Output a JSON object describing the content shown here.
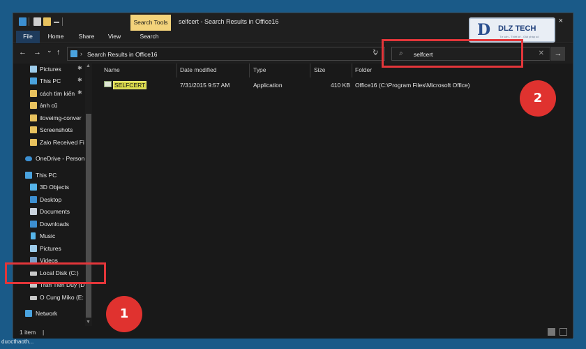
{
  "window": {
    "title": "selfcert - Search Results in Office16",
    "context_tab": "Search Tools",
    "close_icon": "×"
  },
  "ribbon": {
    "tabs": [
      "File",
      "Home",
      "Share",
      "View",
      "Search"
    ]
  },
  "nav": {
    "back": "←",
    "forward": "→",
    "recent": "⌄",
    "up": "↑"
  },
  "address": {
    "path": "Search Results in Office16",
    "separator": "›",
    "dropdown": "⌄",
    "refresh": "↻"
  },
  "search": {
    "icon": "⌕",
    "value": "selfcert",
    "clear": "✕",
    "go": "→"
  },
  "sidebar": {
    "items": [
      {
        "label": "Pictures",
        "icon": "pictures-icon",
        "pinned": true
      },
      {
        "label": "This PC",
        "icon": "pc-icon",
        "pinned": true
      },
      {
        "label": "cách tìm kiến",
        "icon": "folder-icon",
        "pinned": true
      },
      {
        "label": "ảnh cũ",
        "icon": "folder-icon",
        "pinned": false
      },
      {
        "label": "iloveimg-conver",
        "icon": "folder-icon",
        "pinned": false
      },
      {
        "label": "Screenshots",
        "icon": "folder-icon",
        "pinned": false
      },
      {
        "label": "Zalo Received Fi",
        "icon": "folder-icon",
        "pinned": false
      },
      {
        "label": "OneDrive - Person",
        "icon": "cloud-icon",
        "pinned": false
      },
      {
        "label": "This PC",
        "icon": "pc-icon",
        "pinned": false
      },
      {
        "label": "3D Objects",
        "icon": "cube-icon",
        "pinned": false
      },
      {
        "label": "Desktop",
        "icon": "desktop-icon",
        "pinned": false
      },
      {
        "label": "Documents",
        "icon": "documents-icon",
        "pinned": false
      },
      {
        "label": "Downloads",
        "icon": "downloads-icon",
        "pinned": false
      },
      {
        "label": "Music",
        "icon": "music-icon",
        "pinned": false
      },
      {
        "label": "Pictures",
        "icon": "pictures-icon",
        "pinned": false
      },
      {
        "label": "Videos",
        "icon": "videos-icon",
        "pinned": false
      },
      {
        "label": "Local Disk (C:)",
        "icon": "drive-icon",
        "pinned": false
      },
      {
        "label": "Tran Tien Duy (D",
        "icon": "drive-icon",
        "pinned": false
      },
      {
        "label": "O Cung Miko (E:",
        "icon": "drive-icon",
        "pinned": false
      },
      {
        "label": "Network",
        "icon": "network-icon",
        "pinned": false
      }
    ],
    "pin_glyph": "📌"
  },
  "columns": {
    "name": "Name",
    "date": "Date modified",
    "type": "Type",
    "size": "Size",
    "folder": "Folder"
  },
  "files": [
    {
      "name": "SELFCERT",
      "date": "7/31/2015 9:57 AM",
      "type": "Application",
      "size": "410 KB",
      "folder": "Office16 (C:\\Program Files\\Microsoft Office)"
    }
  ],
  "status": {
    "count": "1 item",
    "caret": "|"
  },
  "annotations": {
    "badge1": "1",
    "badge2": "2"
  },
  "logo": {
    "mark": "D",
    "text": "DLZ TECH",
    "sub": "Tư vấn - Thiết kế - Giải pháp số"
  },
  "caption": "duocthaoth...",
  "colors": {
    "accent_red": "#e3363a",
    "search_tools_tab": "#f3d37b",
    "highlight": "#d7d74a",
    "background": "#1a5a88"
  }
}
